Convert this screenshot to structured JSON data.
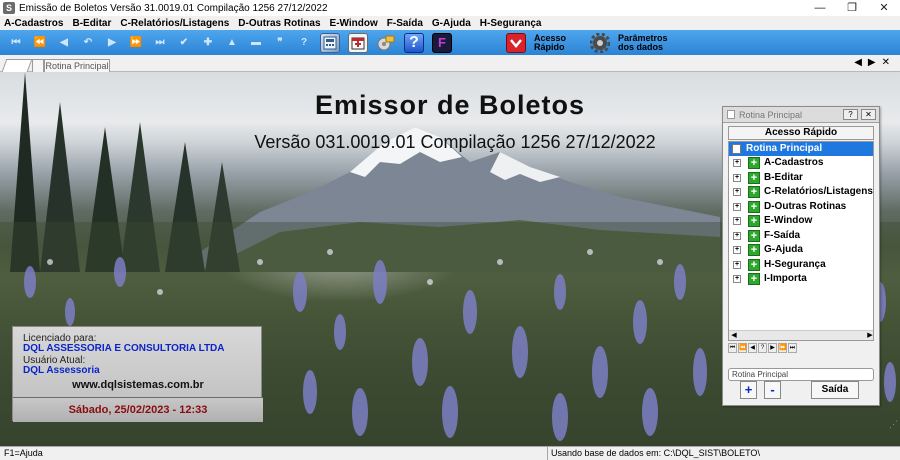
{
  "window": {
    "title": "Emissão de Boletos  Versão  31.0019.01 Compilação 1256  27/12/2022",
    "app_icon": "S",
    "minimize": "—",
    "restore": "❐",
    "close": "✕"
  },
  "menu": {
    "items": [
      "A-Cadastros",
      "B-Editar",
      "C-Relatórios/Listagens",
      "D-Outras Rotinas",
      "E-Window",
      "F-Saída",
      "G-Ajuda",
      "H-Segurança"
    ]
  },
  "toolbar": {
    "nav_glyphs": [
      "⏮",
      "⏪",
      "◀",
      "↶",
      "▶",
      "⏩",
      "⏭",
      "✔",
      "✚",
      "▲",
      "▬",
      "❞",
      "?"
    ],
    "quick_access_label_1": "Acesso",
    "quick_access_label_2": "Rápido",
    "params_label_1": "Parâmetros",
    "params_label_2": "dos dados",
    "help_glyph": "?",
    "f_glyph": "F"
  },
  "tabs": {
    "main_tab": "Rotina Principal",
    "arrows": "◀▶✕"
  },
  "main": {
    "title": "Emissor de Boletos",
    "version_line": "Versão 031.0019.01 Compilação 1256  27/12/2022"
  },
  "license": {
    "licensed_label": "Licenciado para:",
    "licensed_value": "DQL ASSESSORIA E CONSULTORIA LTDA",
    "user_label": "Usuário Atual:",
    "user_value": "DQL Assessoria",
    "website": "www.dqlsistemas.com.br",
    "datetime": "Sábado, 25/02/2023 - 12:33"
  },
  "panel": {
    "title": "Rotina Principal",
    "help_btn": "?",
    "close_btn": "✕",
    "header": "Acesso Rápido",
    "root": "Rotina Principal",
    "items": [
      "A-Cadastros",
      "B-Editar",
      "C-Relatórios/Listagens",
      "D-Outras Rotinas",
      "E-Window",
      "F-Saída",
      "G-Ajuda",
      "H-Segurança",
      "I-Importa"
    ],
    "field_value": "Rotina Principal",
    "add_btn": "+",
    "remove_btn": "-",
    "exit_btn": "Saída"
  },
  "status": {
    "left": "F1=Ajuda",
    "right": "Usando base de dados em: C:\\DQL_SIST\\BOLETO\\"
  }
}
